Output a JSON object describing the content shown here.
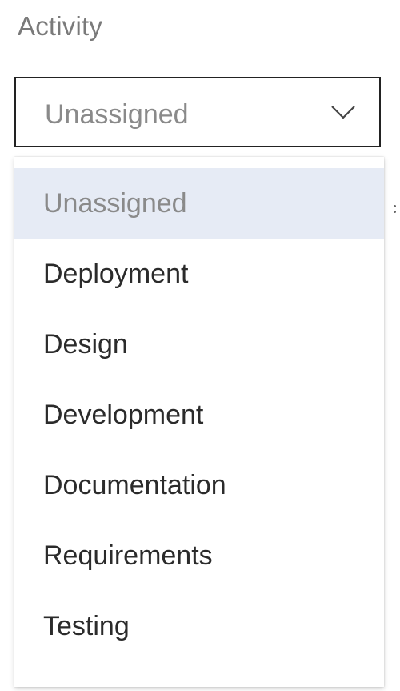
{
  "field": {
    "label": "Activity",
    "selected_value": "Unassigned"
  },
  "dropdown": {
    "options": [
      {
        "label": "Unassigned",
        "selected": true
      },
      {
        "label": "Deployment",
        "selected": false
      },
      {
        "label": "Design",
        "selected": false
      },
      {
        "label": "Development",
        "selected": false
      },
      {
        "label": "Documentation",
        "selected": false
      },
      {
        "label": "Requirements",
        "selected": false
      },
      {
        "label": "Testing",
        "selected": false
      }
    ]
  },
  "icons": {
    "chevron": "chevron-down-icon"
  },
  "colors": {
    "selected_option_bg": "#e6ebf5",
    "select_border": "#222222"
  }
}
